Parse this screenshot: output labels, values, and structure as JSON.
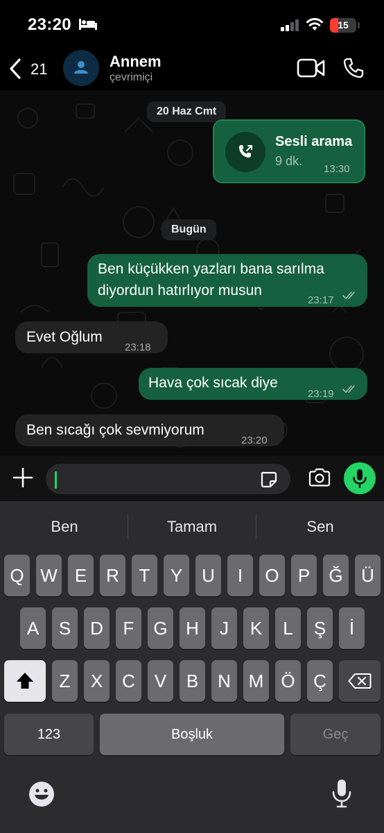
{
  "status_bar": {
    "time": "23:20",
    "battery": "15",
    "icons": [
      "bed-icon",
      "signal-icon",
      "wifi-icon",
      "battery-icon"
    ]
  },
  "header": {
    "back_count": "21",
    "contact_name": "Annem",
    "contact_status": "çevrimiçi",
    "icons": [
      "chevron-left-icon",
      "person-icon",
      "video-call-icon",
      "phone-icon"
    ]
  },
  "chat": {
    "date_1": "20 Haz Cmt",
    "call_card": {
      "title": "Sesli arama",
      "duration": "9 dk.",
      "time": "13:30",
      "icon": "outgoing-call-icon"
    },
    "date_2": "Bugün",
    "messages": [
      {
        "direction": "out",
        "text_line1": "Ben küçükken yazları bana sarılma",
        "text_line2": "diyordun hatırlıyor musun",
        "time": "23:17",
        "read": true
      },
      {
        "direction": "in",
        "text": "Evet Oğlum",
        "time": "23:18"
      },
      {
        "direction": "out",
        "text": "Hava çok sıcak diye",
        "time": "23:19",
        "read": true
      },
      {
        "direction": "in",
        "text": "Ben sıcağı çok sevmiyorum",
        "time": "23:20"
      }
    ],
    "colors": {
      "outgoing": "#15603e",
      "incoming": "#232323",
      "accent": "#25d366"
    }
  },
  "input_bar": {
    "value": "",
    "icons": [
      "plus-icon",
      "sticker-icon",
      "camera-icon",
      "microphone-icon"
    ]
  },
  "keyboard": {
    "suggestions": [
      "Ben",
      "Tamam",
      "Sen"
    ],
    "row1": [
      "Q",
      "W",
      "E",
      "R",
      "T",
      "Y",
      "U",
      "I",
      "O",
      "P",
      "Ğ",
      "Ü"
    ],
    "row2": [
      "A",
      "S",
      "D",
      "F",
      "G",
      "H",
      "J",
      "K",
      "L",
      "Ş",
      "İ"
    ],
    "row3": [
      "Z",
      "X",
      "C",
      "V",
      "B",
      "N",
      "M",
      "Ö",
      "Ç"
    ],
    "numbers_label": "123",
    "space_label": "Boşluk",
    "return_label": "Geç",
    "icons": [
      "shift-icon",
      "backspace-icon",
      "emoji-icon",
      "dictation-icon"
    ]
  }
}
